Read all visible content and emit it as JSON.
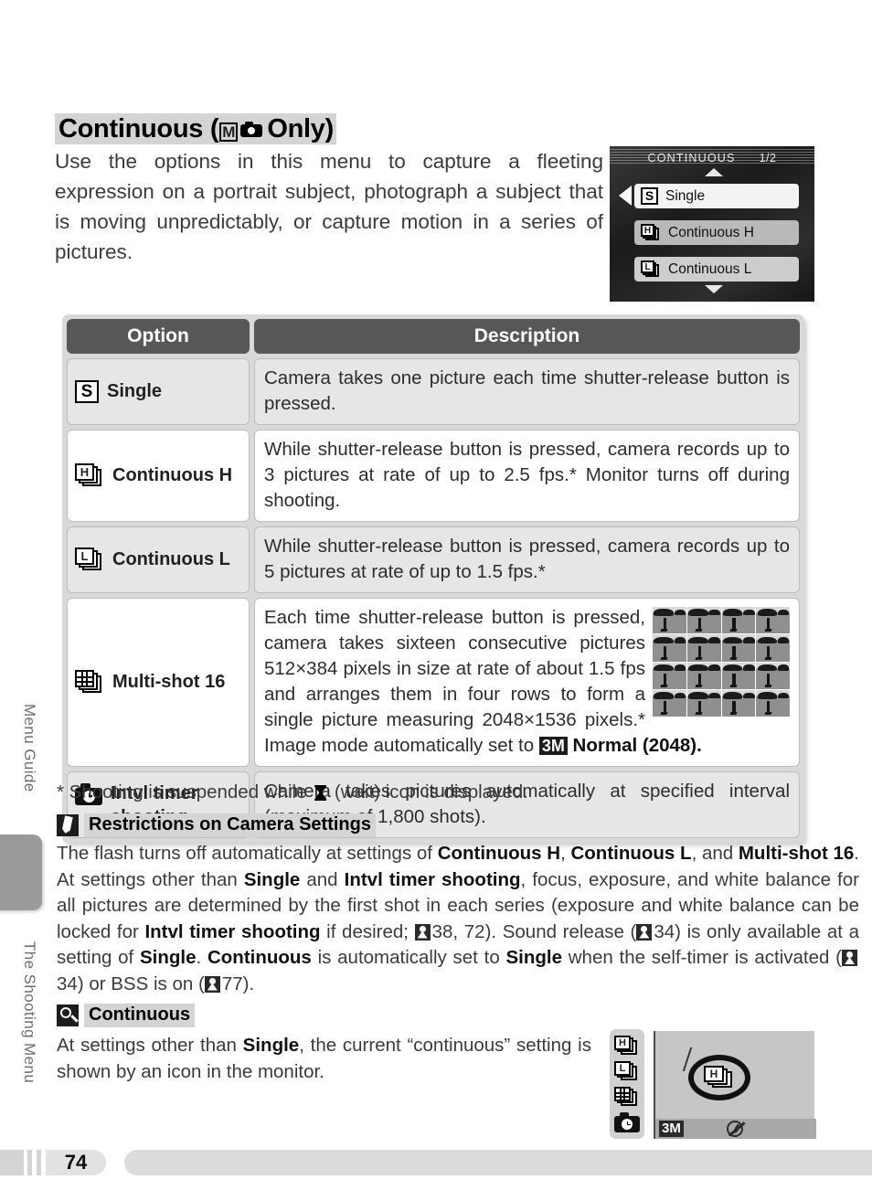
{
  "sidebar": {
    "label_menu_guide": "Menu Guide",
    "label_shooting_menu": "The Shooting Menu"
  },
  "page": {
    "number": "74",
    "title_prefix": "Continuous (",
    "title_mode_badge": "M",
    "title_suffix": " Only)",
    "intro": "Use the options in this menu to capture a fleeting expression on a portrait subject, photograph a subject that is moving unpredictably, or capture motion in a series of pictures."
  },
  "camera_menu": {
    "title": "CONTINUOUS",
    "page_indicator": "1/2",
    "items": [
      {
        "icon": "S",
        "label": "Single",
        "selected": true
      },
      {
        "icon": "H",
        "label": "Continuous H",
        "selected": false
      },
      {
        "icon": "L",
        "label": "Continuous L",
        "selected": false
      }
    ]
  },
  "table": {
    "headers": {
      "option": "Option",
      "description": "Description"
    },
    "rows": [
      {
        "icon": "single-icon",
        "option": "Single",
        "description": "Camera takes one picture each time shutter-release button is pressed."
      },
      {
        "icon": "continuous-h-icon",
        "option": "Continuous H",
        "description": "While shutter-release button is pressed, camera records up to 3 pictures at rate of up to 2.5 fps.*  Monitor turns off during shooting."
      },
      {
        "icon": "continuous-l-icon",
        "option": "Continuous L",
        "description": "While shutter-release button is pressed, camera records up to 5 pictures at rate of up to 1.5 fps.*"
      },
      {
        "icon": "multi-shot-16-icon",
        "option": "Multi-shot 16",
        "description_part1": "Each time shutter-release button is pressed, camera takes sixteen consecutive pictures 512×384 pixels in size at rate of about 1.5 fps and arranges them in four rows to form a single picture measuring 2048×1536 pixels.*  Image mode automatically set to ",
        "image_mode_badge": "3M",
        "description_part2": " Normal (2048)."
      },
      {
        "icon": "intvl-timer-icon",
        "option_line1": "Intvl timer",
        "option_line2": "shooting",
        "description": "Camera takes pictures automatically at specified interval (maximum of 1,800 shots)."
      }
    ]
  },
  "footnote": {
    "prefix": "* Shooting is suspended while ",
    "suffix": " (wait) icon is displayed."
  },
  "tip1": {
    "heading": "Restrictions on Camera Settings",
    "t1": "The flash turns off automatically at settings of ",
    "b1": "Continuous H",
    "t2": ", ",
    "b2": "Continuous L",
    "t3": ", and ",
    "b3": "Multi-shot 16",
    "t4": ".  At settings other than ",
    "b4": "Single",
    "t5": " and ",
    "b5": "Intvl timer shooting",
    "t6": ", focus, exposure, and white balance for all pictures are determined by the first shot in each series (exposure and white balance can be locked for ",
    "b6": "Intvl timer shooting",
    "t7": " if desired; ",
    "ref1": "38, 72",
    "t8": ").  Sound release (",
    "ref2": "34",
    "t9": ") is only available at a setting of ",
    "b7": "Single",
    "t10": ".  ",
    "b8": "Continuous",
    "t11": " is automatically set to ",
    "b9": "Single",
    "t12": " when the self-timer is activated (",
    "ref3": "34",
    "t13": ") or BSS is on (",
    "ref4": "77",
    "t14": ")."
  },
  "tip2": {
    "heading": "Continuous",
    "t1": "At settings other than ",
    "b1": "Single",
    "t2": ", the current “continuous” setting is shown by an icon in the monitor."
  },
  "monitor_illustration": {
    "icons": [
      "continuous-h-icon",
      "continuous-l-icon",
      "multi-shot-16-icon",
      "intvl-timer-icon"
    ],
    "image_mode_badge": "3M",
    "flash_status": "flash-off-icon"
  },
  "colors": {
    "table_header_bg": "#575757",
    "table_frame_bg": "#d9d9d9",
    "row_gray_bg": "#e6e6e6",
    "row_white_bg": "#ffffff",
    "highlight_bg": "#d4d4d4",
    "body_text": "#3b3b3d"
  }
}
